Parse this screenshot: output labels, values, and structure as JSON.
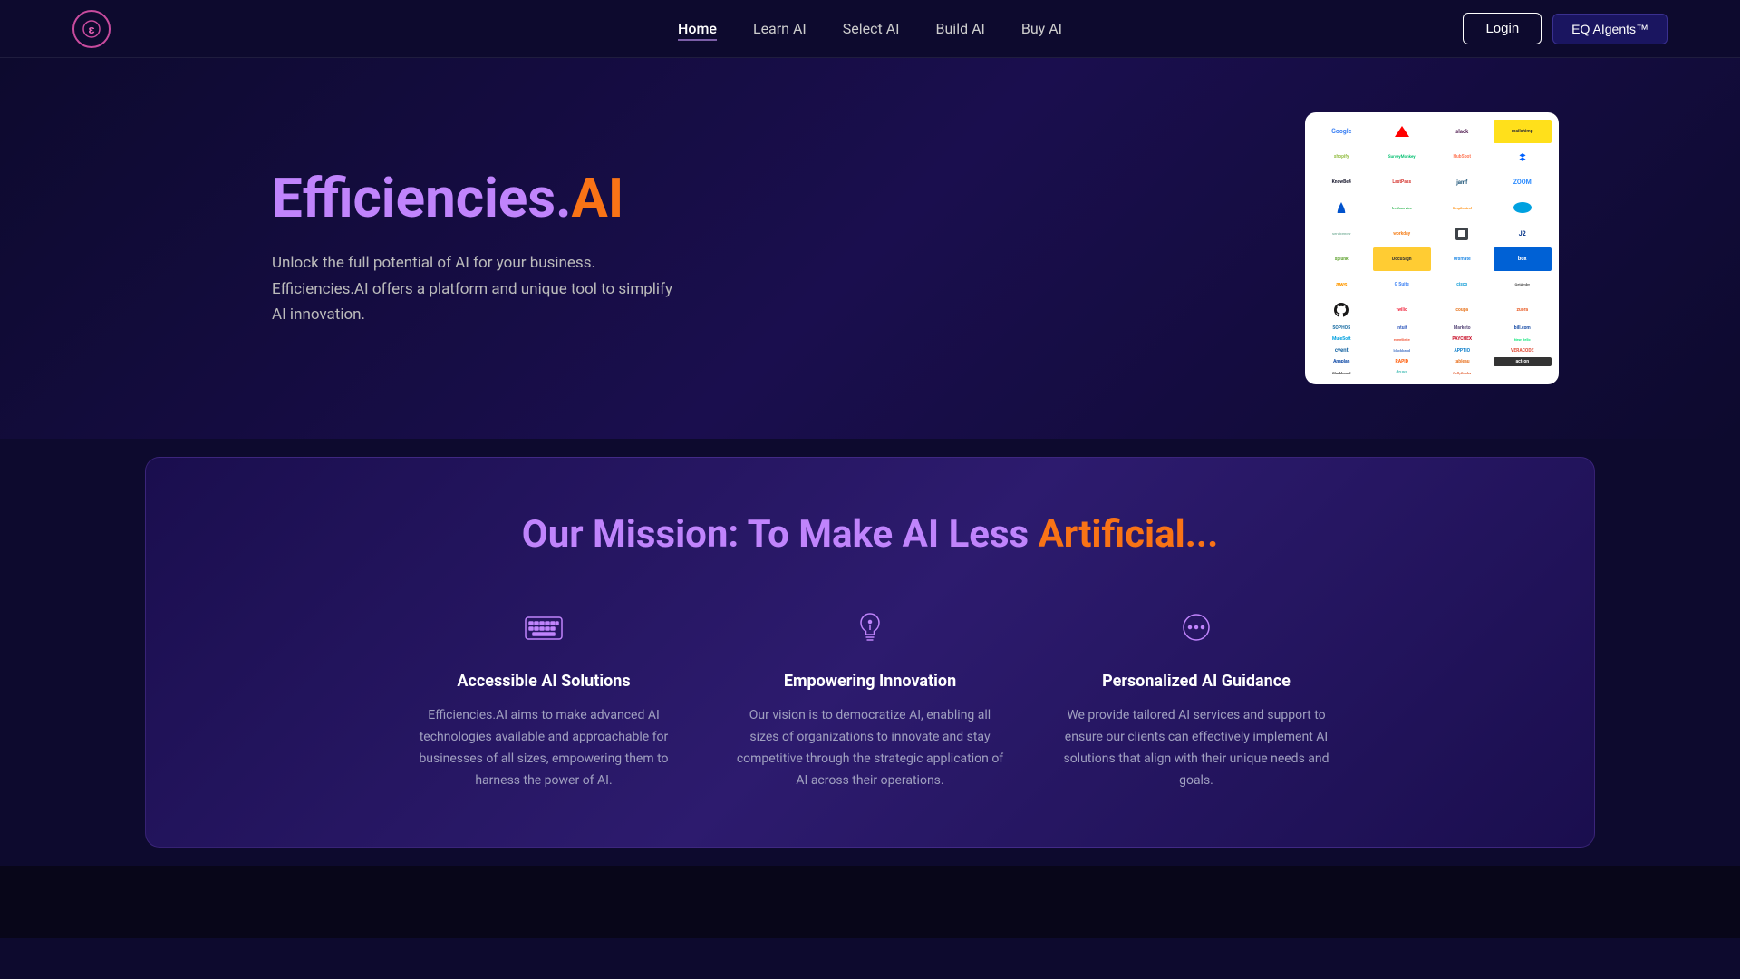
{
  "nav": {
    "logo_symbol": "ε",
    "links": [
      {
        "label": "Home",
        "active": true
      },
      {
        "label": "Learn AI",
        "active": false
      },
      {
        "label": "Select AI",
        "active": false
      },
      {
        "label": "Build AI",
        "active": false
      },
      {
        "label": "Buy AI",
        "active": false
      }
    ],
    "login_label": "Login",
    "eq_label": "EQ AIgents™"
  },
  "hero": {
    "title_purple": "Efficiencies.",
    "title_orange": "AI",
    "subtitle": "Unlock the full potential of AI for your business. Efficiencies.AI offers a platform and unique tool to simplify AI innovation."
  },
  "mission": {
    "title_part1": "Our Mission: To Make AI Less ",
    "title_part2": "Artificial...",
    "cards": [
      {
        "icon": "keyboard",
        "title": "Accessible AI Solutions",
        "desc": "Efficiencies.AI aims to make advanced AI technologies available and approachable for businesses of all sizes, empowering them to harness the power of AI."
      },
      {
        "icon": "lightbulb",
        "title": "Empowering Innovation",
        "desc": "Our vision is to democratize AI, enabling all sizes of organizations to innovate and stay competitive through the strategic application of AI across their operations."
      },
      {
        "icon": "chat",
        "title": "Personalized AI Guidance",
        "desc": "We provide tailored AI services and support to ensure our clients can effectively implement AI solutions that align with their unique needs and goals."
      }
    ]
  },
  "logos": [
    "Google",
    "Adobe",
    "Slack",
    "Mailchimp",
    "Shopify",
    "SurveyMonkey",
    "HubSpot",
    "Dropbox",
    "KnowBe4",
    "LastPass",
    "Jamf",
    "Zoom",
    "Atlassian",
    "Freshservice",
    "RingCentral",
    "Salesforce",
    "ServiceNow",
    "Workday",
    "Square",
    "J2",
    "Splunk",
    "DocuSign",
    "Ultimate",
    "Box",
    "AWS",
    "GSuite",
    "Cisco",
    "GetAmbly",
    "GitHub",
    "Twilio",
    "Coupa",
    "Zuora",
    "Adobe",
    "Sophos",
    "Intuit",
    "Marketo",
    "BillCom",
    "MuleSoft",
    "Formic",
    "Eventbrite",
    "Paychex",
    "NewRelic",
    "Cvent",
    "Blackbaud",
    "Apptio",
    "Veracode",
    "Anaplan",
    "RapidG",
    "G2",
    "Tableau",
    "ActOn",
    "Blackboard",
    "Druva",
    "RellyBooks"
  ]
}
